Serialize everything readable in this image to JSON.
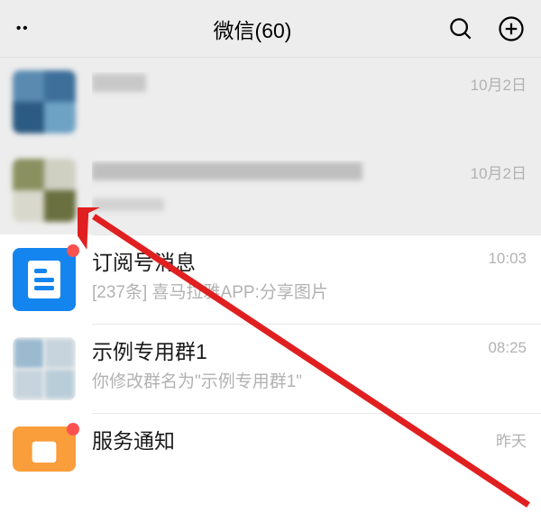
{
  "header": {
    "title": "微信(60)",
    "menu_icon": "dots-icon",
    "search_icon": "search-icon",
    "add_icon": "plus-circle-icon"
  },
  "chats": [
    {
      "name": "",
      "preview": "",
      "time": "10月2日",
      "avatar_type": "blur1",
      "highlighted": true,
      "redacted": true,
      "badge": false
    },
    {
      "name": "",
      "preview": "",
      "time": "10月2日",
      "avatar_type": "blur2",
      "highlighted": true,
      "redacted": true,
      "badge": false
    },
    {
      "name": "订阅号消息",
      "preview": "[237条] 喜马拉雅APP:分享图片",
      "time": "10:03",
      "avatar_type": "subscription",
      "highlighted": false,
      "redacted": false,
      "badge": true
    },
    {
      "name": "示例专用群1",
      "preview": "你修改群名为\"示例专用群1\"",
      "time": "08:25",
      "avatar_type": "group",
      "highlighted": false,
      "redacted": false,
      "badge": false
    },
    {
      "name": "服务通知",
      "preview": "",
      "time": "昨天",
      "avatar_type": "service",
      "highlighted": false,
      "redacted": false,
      "badge": true
    }
  ],
  "annotation": {
    "arrow_color": "#e02020"
  }
}
